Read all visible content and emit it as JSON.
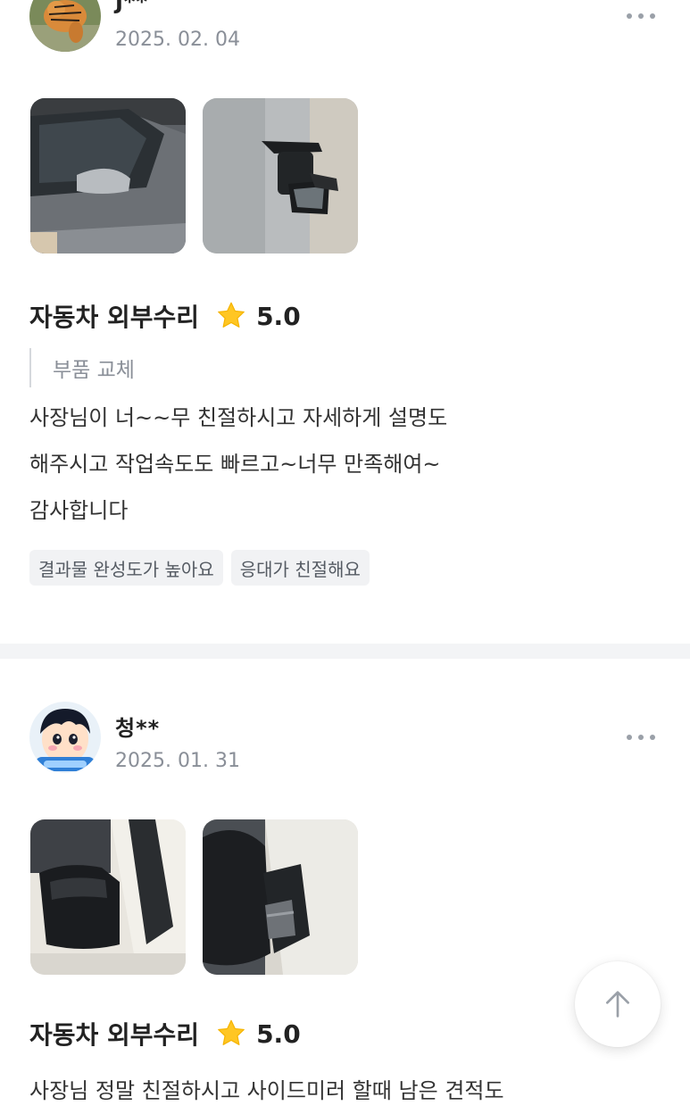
{
  "reviews": [
    {
      "username": "J**",
      "date": "2025. 02. 04",
      "service": "자동차 외부수리",
      "rating": "5.0",
      "option": "부품 교체",
      "text": "사장님이 너~~무 친절하시고 자세하게 설명도\n해주시고 작업속도도 빠르고~너무 만족해여~\n감사합니다",
      "tags": [
        "결과물 완성도가 높아요",
        "응대가 친절해요"
      ]
    },
    {
      "username": "청**",
      "date": "2025. 01. 31",
      "service": "자동차 외부수리",
      "rating": "5.0",
      "text": "사장님 정말 친절하시고 사이드미러 할때 남은 견적도"
    }
  ],
  "colors": {
    "star": "#FFC623",
    "muted": "#8A8F98",
    "tag_bg": "#F1F2F4",
    "divider": "#F3F4F6"
  },
  "icons": {
    "more": "more-horizontal-icon",
    "star": "star-icon",
    "scroll_top": "arrow-up-icon"
  }
}
